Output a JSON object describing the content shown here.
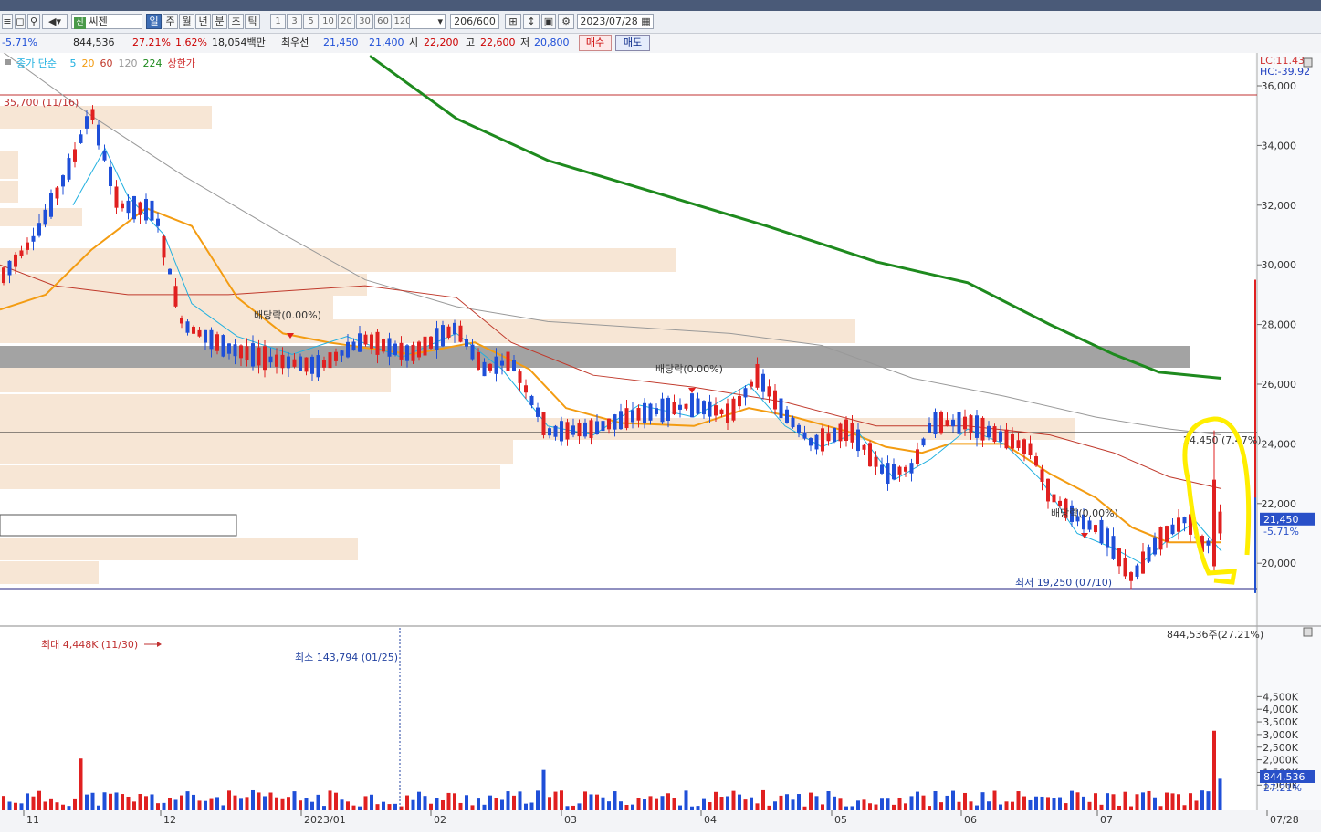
{
  "toolbar": {
    "stock_name": "씨젠",
    "periods": [
      "일",
      "주",
      "월",
      "년",
      "분",
      "초",
      "틱"
    ],
    "selected_period": "일",
    "minute_options": [
      "1",
      "3",
      "5",
      "10",
      "20",
      "30",
      "60",
      "120"
    ],
    "bar_count": "206",
    "bar_total": "/600",
    "date": "2023/07/28"
  },
  "infobar": {
    "change_pct": "-5.71%",
    "volume": "844,536",
    "turnover": "27.21%",
    "ratio": "1.62%",
    "amount": "18,054백만",
    "best_label": "최우선",
    "best_ask": "21,450",
    "best_bid": "21,400",
    "open_label": "시",
    "open": "22,200",
    "high_label": "고",
    "high": "22,600",
    "low_label": "저",
    "low": "20,800",
    "buy_label": "매수",
    "sell_label": "매도"
  },
  "legend": {
    "price_label": "종가 단순",
    "ma5": "5",
    "ma20": "20",
    "ma60": "60",
    "ma120": "120",
    "ma224": "224",
    "limit_up": "상한가"
  },
  "colors": {
    "up": "#e02020",
    "down": "#1f4fd8",
    "ma5": "#20b0e0",
    "ma20": "#f39c12",
    "ma60": "#c0392b",
    "ma120": "#999999",
    "ma224": "#1e8a1e",
    "volume_profile": "#f7e6d5",
    "highlight": "#ffee00"
  },
  "chart_data": {
    "type": "candlestick",
    "y_price_ticks": [
      "36,000",
      "34,000",
      "32,000",
      "30,000",
      "28,000",
      "26,000",
      "24,000",
      "22,000",
      "20,000"
    ],
    "y_volume_ticks": [
      "4,500K",
      "4,000K",
      "3,500K",
      "3,000K",
      "2,500K",
      "2,000K",
      "1,500K",
      "1,000K"
    ],
    "x_ticks": [
      "11",
      "12",
      "2023/01",
      "02",
      "03",
      "04",
      "05",
      "06",
      "07",
      "07/28"
    ],
    "lc": "LC:11.43",
    "hc": "HC:-39.92",
    "annotations": {
      "high_label": "35,700 (11/16)",
      "low_label": "최저 19,250 (07/10)",
      "last_high_label": "24,450 (7.47%)",
      "dividend_label": "배당락(0.00%)",
      "current_price": "21,450",
      "current_change": "-5.71%",
      "vol_max_label": "최대 4,448K (11/30)",
      "vol_min_label": "최소 143,794 (01/25)",
      "vol_current_label": "844,536주(27.21%)",
      "vol_current": "844,536",
      "vol_current_pct": "27.21%"
    }
  }
}
